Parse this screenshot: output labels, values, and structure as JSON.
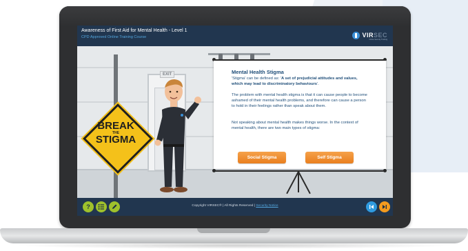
{
  "course": {
    "title": "Awareness of First Aid for Mental Health - Level 1",
    "subtitle": "CPD Approved Online Training Course"
  },
  "brand": {
    "logo_text_main": "VIR",
    "logo_text_tail": "SEC",
    "logo_tagline": "Online Security Training"
  },
  "scene": {
    "exit_sign": "EXIT",
    "sign_line1": "BREAK",
    "sign_the": "THE",
    "sign_line2": "STIGMA"
  },
  "content": {
    "heading": "Mental Health Stigma",
    "definition_prefix": "'Stigma' can be defined as: '",
    "definition_quote": "A set of prejudicial attitudes and values, which may lead to discriminatory behaviours",
    "definition_suffix": "'.",
    "paragraph2": "The problem with mental health stigma is that it can cause people to become ashamed of their mental health problems, and therefore can cause a person to hold in their feelings rather than speak about them.",
    "paragraph3": "Not speaking about mental health makes things worse. In the context of mental health, there are two main types of stigma:"
  },
  "buttons": {
    "social_stigma": "Social Stigma",
    "self_stigma": "Self Stigma"
  },
  "toolbar": {
    "help_icon": "?",
    "menu_icon": "list-icon",
    "notes_icon": "pencil-icon"
  },
  "footer": {
    "copyright": "Copyright VIRSEC® | All Rights Reserved |",
    "security_link": "Security Notice"
  },
  "navigation": {
    "prev_icon": "skip-back-icon",
    "next_icon": "skip-forward-icon"
  },
  "colors": {
    "header": "#21364f",
    "accent_orange": "#e97f1e",
    "accent_green": "#9fc12c",
    "accent_blue": "#2f9be0",
    "text_blue": "#1f4e79"
  }
}
